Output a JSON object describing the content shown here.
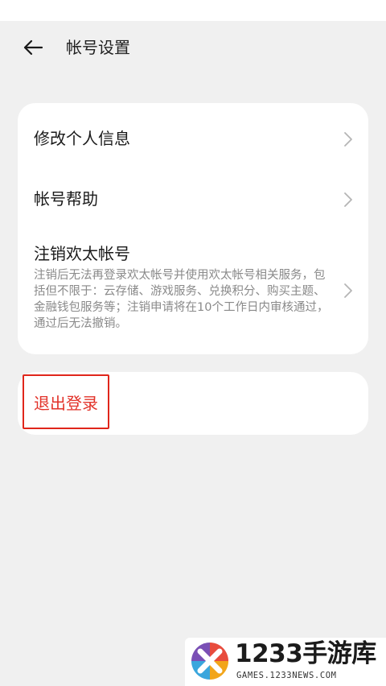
{
  "header": {
    "back_icon": "arrow-left-icon",
    "title": "帐号设置"
  },
  "settings": {
    "items": [
      {
        "label": "修改个人信息",
        "icon": "chevron-right-icon"
      },
      {
        "label": "帐号帮助",
        "icon": "chevron-right-icon"
      },
      {
        "label": "注销欢太帐号",
        "description": "注销后无法再登录欢太帐号并使用欢太帐号相关服务，包括但不限于：云存储、游戏服务、兑换积分、购买主题、金融钱包服务等；注销申请将在10个工作日内审核通过，通过后无法撤销。",
        "icon": "chevron-right-icon"
      }
    ]
  },
  "logout": {
    "label": "退出登录",
    "highlight_color": "#e0261b"
  },
  "watermark": {
    "brand": "1233手游库",
    "domain": "GAMES.1233NEWS.COM"
  },
  "colors": {
    "background": "#f0f0f0",
    "card": "#ffffff",
    "danger_text": "#e2332a",
    "chevron": "#b5b5b5"
  }
}
